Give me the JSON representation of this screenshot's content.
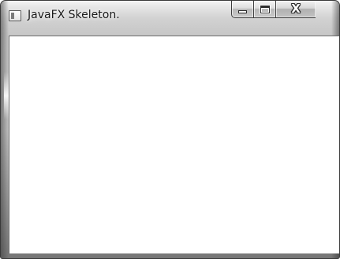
{
  "window": {
    "title": "JavaFX Skeleton.",
    "icon": "application-icon"
  },
  "caption_buttons": {
    "minimize": {
      "icon": "minimize-icon"
    },
    "maximize": {
      "icon": "maximize-icon"
    },
    "close": {
      "icon": "close-icon",
      "glyph": "X"
    }
  },
  "colors": {
    "frame": "#c8c8c8",
    "client_background": "#ffffff",
    "title_text": "#1a1a1a"
  }
}
